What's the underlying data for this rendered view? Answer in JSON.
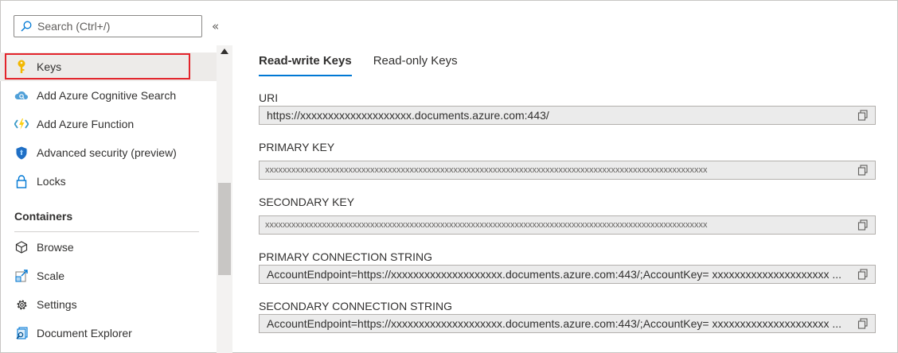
{
  "search": {
    "placeholder": "Search (Ctrl+/)"
  },
  "sidebar": {
    "collapse_glyph": "«",
    "items": [
      {
        "label": "Keys",
        "icon": "key-icon",
        "active": true
      },
      {
        "label": "Add Azure Cognitive Search",
        "icon": "cloud-search-icon"
      },
      {
        "label": "Add Azure Function",
        "icon": "function-icon"
      },
      {
        "label": "Advanced security (preview)",
        "icon": "shield-icon"
      },
      {
        "label": "Locks",
        "icon": "lock-icon"
      }
    ],
    "sections": [
      {
        "title": "Containers",
        "items": [
          {
            "label": "Browse",
            "icon": "cube-icon"
          },
          {
            "label": "Scale",
            "icon": "scale-icon"
          },
          {
            "label": "Settings",
            "icon": "gear-icon"
          },
          {
            "label": "Document Explorer",
            "icon": "document-explorer-icon"
          }
        ]
      }
    ]
  },
  "main": {
    "tabs": [
      {
        "label": "Read-write Keys",
        "selected": true
      },
      {
        "label": "Read-only Keys",
        "selected": false
      }
    ],
    "fields": [
      {
        "label": "URI",
        "value": "https://xxxxxxxxxxxxxxxxxxxx.documents.azure.com:443/"
      },
      {
        "label": "PRIMARY KEY",
        "value": "xxxxxxxxxxxxxxxxxxxxxxxxxxxxxxxxxxxxxxxxxxxxxxxxxxxxxxxxxxxxxxxxxxxxxxxxxxxxxxxxxxxxxxxxxxxxxxxxxxxxx"
      },
      {
        "label": "SECONDARY KEY",
        "value": "xxxxxxxxxxxxxxxxxxxxxxxxxxxxxxxxxxxxxxxxxxxxxxxxxxxxxxxxxxxxxxxxxxxxxxxxxxxxxxxxxxxxxxxxxxxxxxxxxxxxx"
      },
      {
        "label": "PRIMARY CONNECTION STRING",
        "value": "AccountEndpoint=https://xxxxxxxxxxxxxxxxxxxx.documents.azure.com:443/;AccountKey= xxxxxxxxxxxxxxxxxxxxx ..."
      },
      {
        "label": "SECONDARY CONNECTION STRING",
        "value": "AccountEndpoint=https://xxxxxxxxxxxxxxxxxxxx.documents.azure.com:443/;AccountKey= xxxxxxxxxxxxxxxxxxxxx ..."
      }
    ]
  },
  "colors": {
    "accent": "#0078d4",
    "active_outline": "#e3242b",
    "active_bg": "#edebe9",
    "field_bg": "#ebebeb"
  }
}
